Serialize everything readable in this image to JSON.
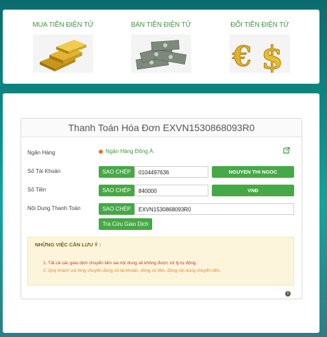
{
  "services": [
    {
      "label": "MUA TIỀN ĐIỆN TỬ",
      "icon": "gold-bars-icon"
    },
    {
      "label": "BÁN TIỀN ĐIỆN TỬ",
      "icon": "money-stack-icon"
    },
    {
      "label": "ĐỔI TIỀN ĐIỆN TỬ",
      "icon": "currency-exchange-icon"
    }
  ],
  "payment": {
    "title": "Thanh Toán Hóa Đơn EXVN1530868093R0",
    "bank_label": "Ngân Hàng",
    "bank_name": "Ngân Hàng Đông Á",
    "account_label": "Số Tài Khoản",
    "account_number": "0104497636",
    "account_holder": "NGUYEN THI NGOC",
    "amount_label": "Số Tiền",
    "amount": "840000",
    "currency": "VNĐ",
    "content_label": "Nội Dung Thanh Toán",
    "content": "EXVN1530868093R0",
    "copy_label": "SAO CHÉP",
    "track_button": "Tra Cứu Giao Dịch"
  },
  "notes": {
    "title": "NHỮNG VIỆC CẦN LƯU Ý :",
    "items": [
      "1. Tất cả các giao dịch chuyển tiền sai nội dung sẽ không được xử lý tự động.",
      "2. Quý khách vui lòng chuyển đúng số tài khoản, đúng số tiền, đúng nội dung chuyển tiền."
    ]
  },
  "colors": {
    "accent_green": "#46a846",
    "note_red": "#c0392b",
    "note_orange": "#e08a2a",
    "note_bg": "#fcf5dc"
  }
}
